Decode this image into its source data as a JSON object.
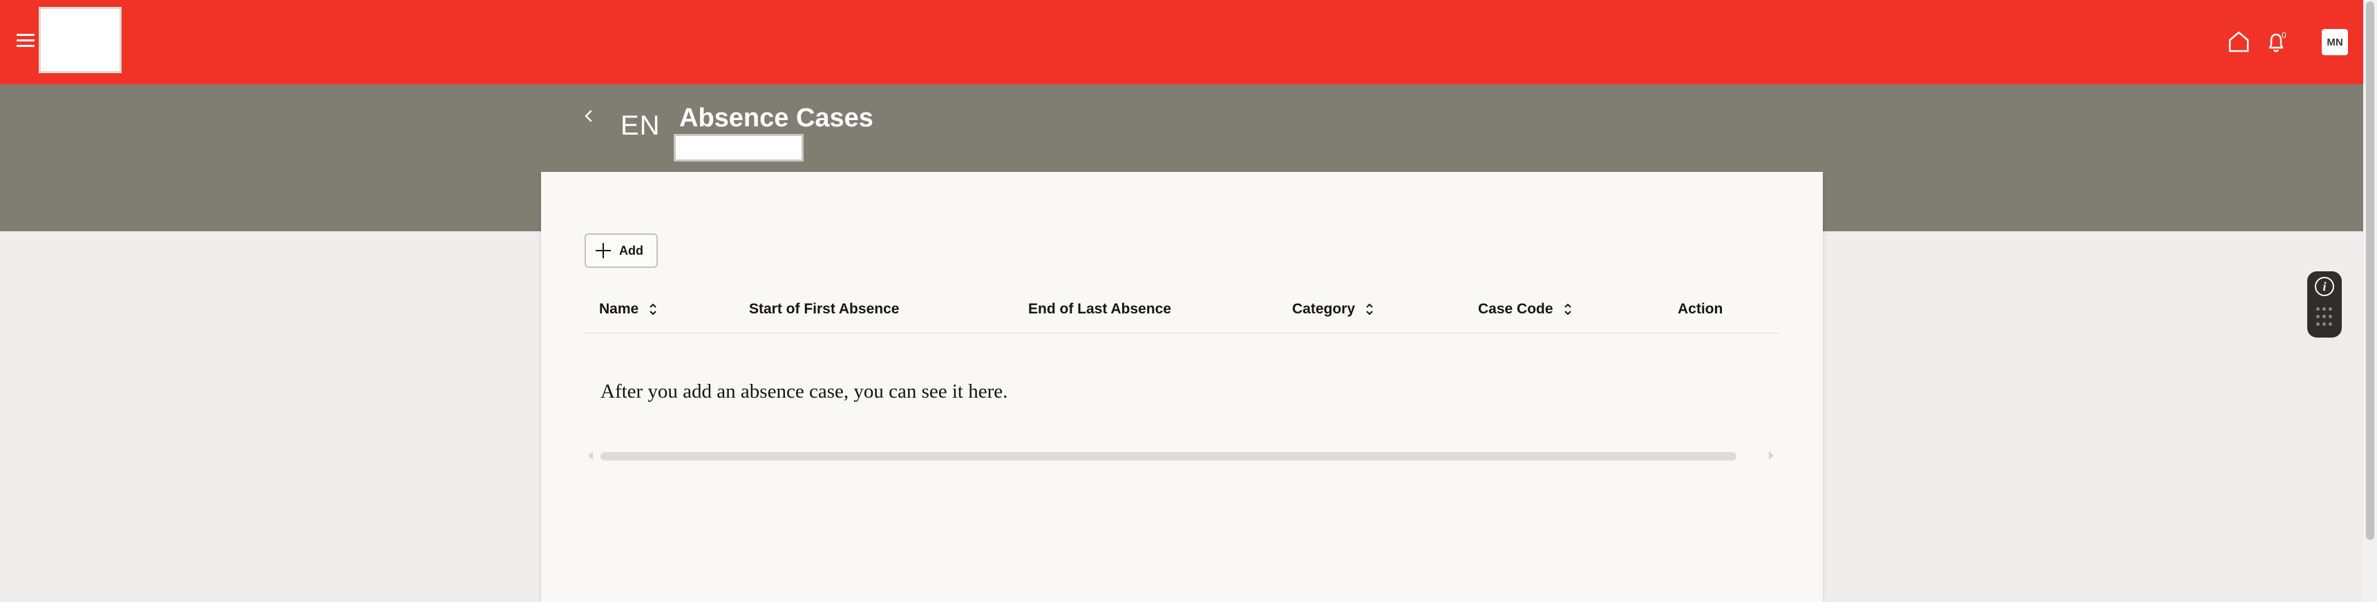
{
  "header": {
    "language": "EN",
    "page_title": "Absence Cases",
    "notification_count": "0",
    "avatar_initials": "MN",
    "brand_color": "#f03326",
    "band_color": "#807d73"
  },
  "toolbar": {
    "add_label": "Add"
  },
  "table": {
    "columns": {
      "name": "Name",
      "start": "Start of First Absence",
      "end": "End of Last Absence",
      "category": "Category",
      "case_code": "Case Code",
      "action": "Action"
    },
    "empty_message": "After you add an absence case, you can see it here."
  },
  "icons": {
    "menu": "hamburger-menu-icon",
    "back": "chevron-left-icon",
    "home": "home-icon",
    "notifications": "bell-icon",
    "sort": "sort-up-down-icon",
    "help": "info-icon"
  }
}
